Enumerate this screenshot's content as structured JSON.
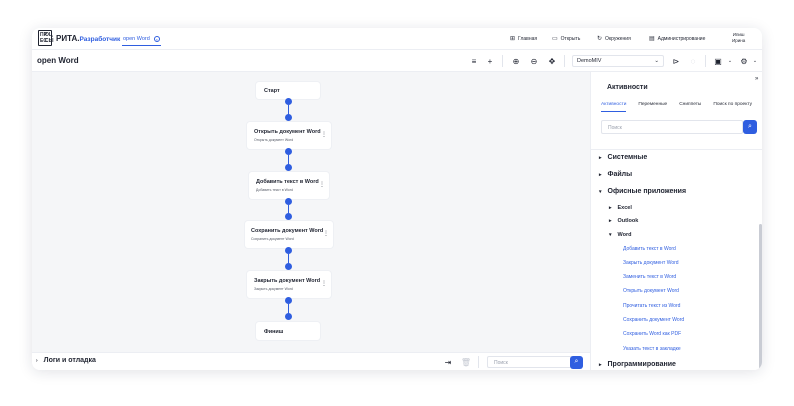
{
  "app": {
    "logo_letters": [
      "ПР",
      "ОЦ",
      "ЕС",
      "СЫ"
    ],
    "brand": "РИТА.",
    "brand_sub": "Разработчик",
    "open_tab": "open Word",
    "nav": [
      {
        "icon": "home-icon",
        "label": "Главная"
      },
      {
        "icon": "folder-icon",
        "label": "Открыть"
      },
      {
        "icon": "refresh-icon",
        "label": "Окружения"
      },
      {
        "icon": "admin-icon",
        "label": "Администрирование"
      }
    ],
    "user_line1": "Ипиш",
    "user_line2": "Ирина"
  },
  "toolbar": {
    "title": "open Word",
    "environment": "DemoMIV"
  },
  "flow": {
    "start": "Старт",
    "finish": "Финиш",
    "steps": [
      {
        "title": "Открыть документ Word",
        "sub": "Открыть документ Word"
      },
      {
        "title": "Добавить текст в Word",
        "sub": "Добавить текст в Word"
      },
      {
        "title": "Сохранить документ Word",
        "sub": "Сохранить документ Word"
      },
      {
        "title": "Закрыть документ Word",
        "sub": "Закрыть документ Word"
      }
    ]
  },
  "bottom": {
    "logs": "Логи и отладка",
    "search_placeholder": "Поиск"
  },
  "panel": {
    "title": "Активности",
    "tabs": [
      "Активности",
      "Переменные",
      "Сниппеты",
      "Поиск по проекту"
    ],
    "search_placeholder": "Поиск",
    "categories": [
      "Системные",
      "Файлы",
      "Офисные приложения"
    ],
    "office_sub": [
      "Excel",
      "Outlook",
      "Word"
    ],
    "word_items": [
      "Добавить текст в Word",
      "Закрыть документ Word",
      "Заменить текст в Word",
      "Открыть документ Word",
      "Прочитать текст из Word",
      "Сохранить документ Word",
      "Сохранить Word как PDF",
      "Указать текст в закладке"
    ],
    "last_category": "Программирование"
  },
  "colors": {
    "accent": "#2f5ee0",
    "canvas": "#f5f6f8"
  }
}
